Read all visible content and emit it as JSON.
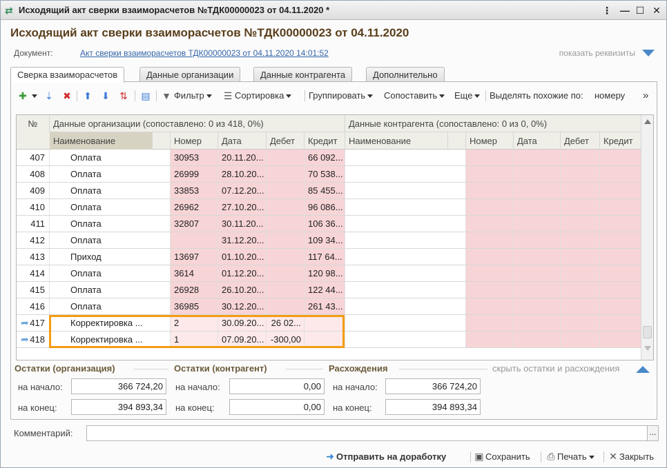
{
  "window": {
    "title": "Исходящий акт сверки взаиморасчетов №ТДК00000023 от 04.11.2020 *",
    "btn_min": "—",
    "btn_max": "☐",
    "btn_close": "✕"
  },
  "doc_title": "Исходящий акт сверки взаиморасчетов №ТДК00000023 от 04.11.2020",
  "document": {
    "label": "Документ:",
    "link": "Акт сверки взаиморасчетов ТДК00000023 от 04.11.2020 14:01:52",
    "show_details": "показать реквизиты"
  },
  "tabs": [
    {
      "label": "Сверка взаиморасчетов"
    },
    {
      "label": "Данные организации"
    },
    {
      "label": "Данные контрагента"
    },
    {
      "label": "Дополнительно"
    }
  ],
  "toolbar": {
    "filter": "Фильтр",
    "sort": "Сортировка",
    "group": "Группировать",
    "match": "Сопоставить",
    "more": "Еще",
    "highlight_label": "Выделять похожие по:",
    "highlight_value": "номеру",
    "overflow": "»"
  },
  "grid": {
    "col_num": "№",
    "group_org": "Данные организации (сопоставлено: 0 из 418, 0%)",
    "group_contr": "Данные контрагента (сопоставлено: 0 из 0, 0%)",
    "cols_org": [
      "Наименование",
      "Номер",
      "Дата",
      "Дебет",
      "Кредит"
    ],
    "cols_contr": [
      "Наименование",
      "Номер",
      "Дата",
      "Дебет",
      "Кредит"
    ],
    "rows": [
      {
        "n": "407",
        "name": "Оплата",
        "number": "30953",
        "date": "20.11.20...",
        "debit": "",
        "credit": "66 092..."
      },
      {
        "n": "408",
        "name": "Оплата",
        "number": "26999",
        "date": "28.10.20...",
        "debit": "",
        "credit": "70 538..."
      },
      {
        "n": "409",
        "name": "Оплата",
        "number": "33853",
        "date": "07.12.20...",
        "debit": "",
        "credit": "85 455..."
      },
      {
        "n": "410",
        "name": "Оплата",
        "number": "26962",
        "date": "27.10.20...",
        "debit": "",
        "credit": "96 086..."
      },
      {
        "n": "411",
        "name": "Оплата",
        "number": "32807",
        "date": "30.11.20...",
        "debit": "",
        "credit": "106 36..."
      },
      {
        "n": "412",
        "name": "Оплата",
        "number": "",
        "date": "31.12.20...",
        "debit": "",
        "credit": "109 34..."
      },
      {
        "n": "413",
        "name": "Приход",
        "number": "13697",
        "date": "01.10.20...",
        "debit": "",
        "credit": "117 64..."
      },
      {
        "n": "414",
        "name": "Оплата",
        "number": "3614",
        "date": "01.12.20...",
        "debit": "",
        "credit": "120 98..."
      },
      {
        "n": "415",
        "name": "Оплата",
        "number": "26928",
        "date": "26.10.20...",
        "debit": "",
        "credit": "122 44..."
      },
      {
        "n": "416",
        "name": "Оплата",
        "number": "36985",
        "date": "30.12.20...",
        "debit": "",
        "credit": "261 43..."
      },
      {
        "n": "417",
        "name": "Корректировка ...",
        "number": "2",
        "date": "30.09.20...",
        "debit": "26 02...",
        "credit": "",
        "icon": "arrow-right-icon"
      },
      {
        "n": "418",
        "name": "Корректировка ...",
        "number": "1",
        "date": "07.09.20...",
        "debit": "-300,00",
        "credit": "",
        "icon": "arrow-right-icon"
      }
    ]
  },
  "balances": {
    "org_title": "Остатки (организация)",
    "contr_title": "Остатки (контрагент)",
    "diff_title": "Расхождения",
    "hide_link": "скрыть остатки и расхождения",
    "start_label": "на начало:",
    "end_label": "на конец:",
    "org_start": "366 724,20",
    "org_end": "394 893,34",
    "contr_start": "0,00",
    "contr_end": "0,00",
    "diff_start": "366 724,20",
    "diff_end": "394 893,34"
  },
  "comment": {
    "label": "Комментарий:",
    "value": "",
    "btn": "..."
  },
  "footer": {
    "send": "Отправить на доработку",
    "save": "Сохранить",
    "print": "Печать",
    "close": "Закрыть"
  },
  "colors": {
    "highlight_border": "#f39c12",
    "pink_cell": "#f7d4d6",
    "title_brown": "#5a3e1b",
    "link_blue": "#3366aa"
  }
}
